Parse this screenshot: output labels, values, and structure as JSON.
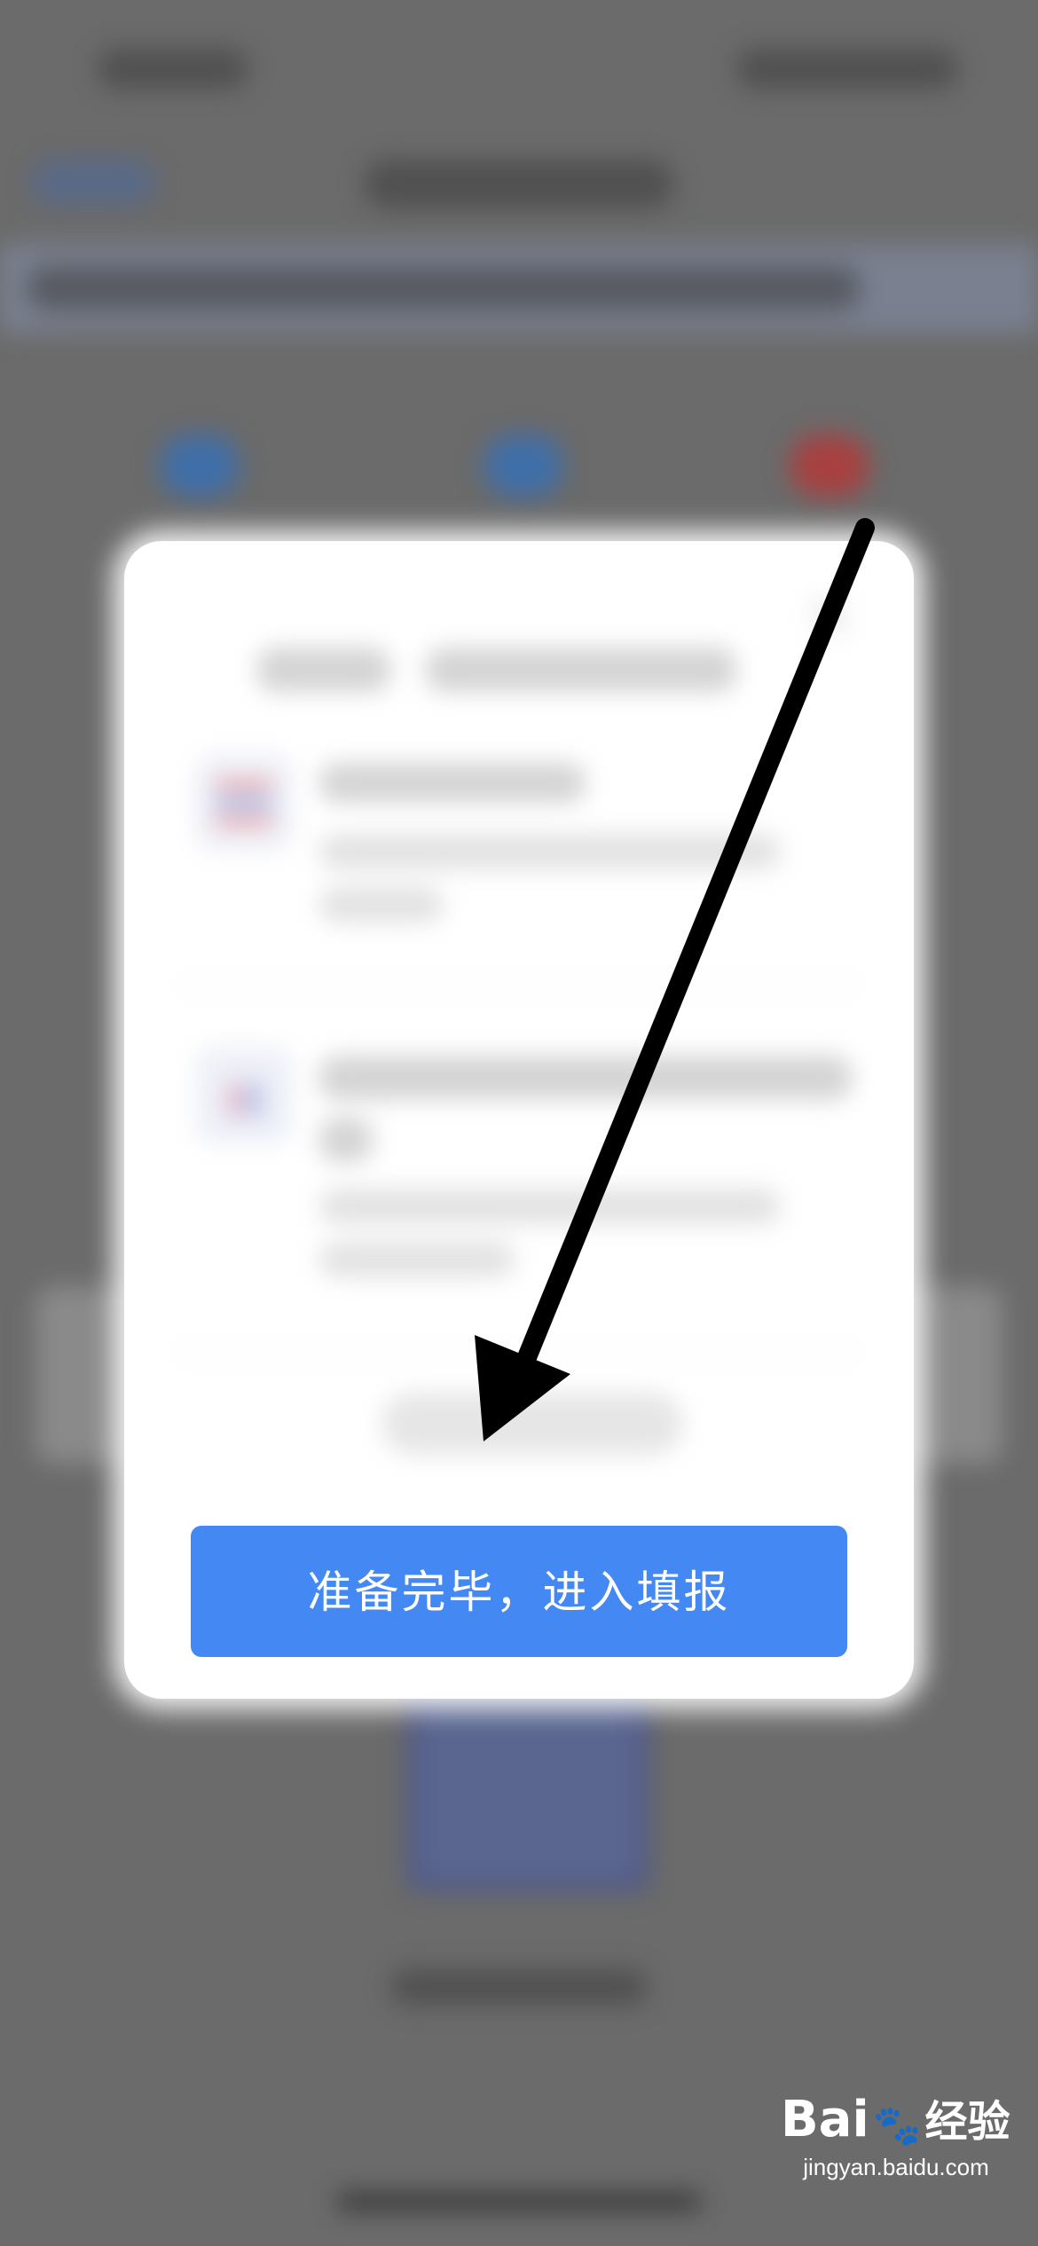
{
  "modal": {
    "confirm_button_label": "准备完毕，进入填报"
  },
  "watermark": {
    "logo_text_left": "Bai",
    "logo_text_right": "经验",
    "paw_icon": "baidu-paw-icon",
    "url": "jingyan.baidu.com"
  },
  "annotation": {
    "arrow_color": "#000000"
  },
  "colors": {
    "accent": "#4488f3",
    "overlay": "#6b6b6b"
  }
}
